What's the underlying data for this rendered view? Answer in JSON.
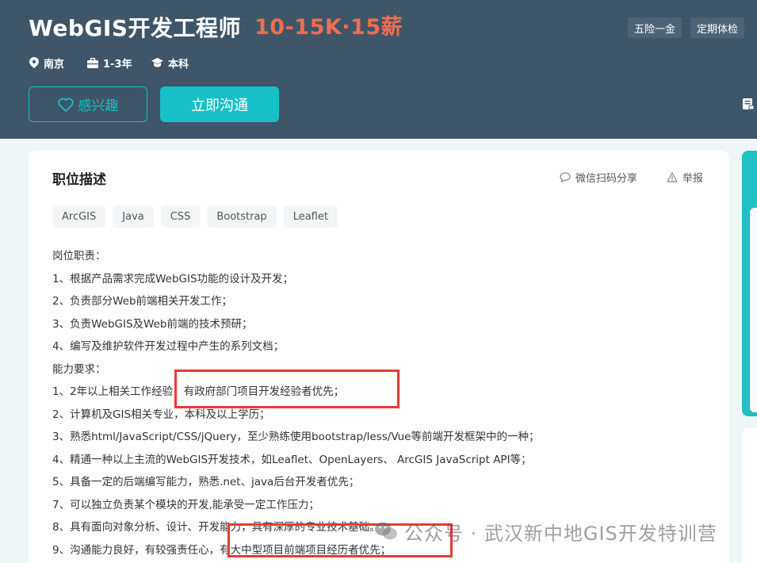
{
  "job": {
    "title": "WebGIS开发工程师",
    "salary": "10-15K·15薪",
    "city": "南京",
    "experience": "1-3年",
    "education": "本科"
  },
  "benefits": [
    "五险一金",
    "定期体检"
  ],
  "actions": {
    "interest_label": "感兴趣",
    "chat_label": "立即沟通"
  },
  "description": {
    "section_title": "职位描述",
    "share_label": "微信扫码分享",
    "report_label": "举报",
    "skills": [
      "ArcGIS",
      "Java",
      "CSS",
      "Bootstrap",
      "Leaflet"
    ],
    "lines": [
      "岗位职责：",
      "1、根据产品需求完成WebGIS功能的设计及开发；",
      "2、负责部分Web前端相关开发工作；",
      "3、负责WebGIS及Web前端的技术预研；",
      "4、编写及维护软件开发过程中产生的系列文档；",
      "能力要求：",
      "1、2年以上相关工作经验，有政府部门项目开发经验者优先；",
      "2、计算机及GIS相关专业，本科及以上学历；",
      "3、熟悉html/JavaScript/CSS/jQuery，至少熟练使用bootstrap/less/Vue等前端开发框架中的一种；",
      "4、精通一种以上主流的WebGIS开发技术，如Leaflet、OpenLayers、 ArcGIS JavaScript API等；",
      "5、具备一定的后端编写能力，熟悉.net、java后台开发者优先；",
      "7、可以独立负责某个模块的开发,能承受一定工作压力；",
      "8、具有面向对象分析、设计、开发能力，具有深厚的专业技术基础。",
      "9、沟通能力良好，有较强责任心，有大中型项目前端项目经历者优先；"
    ]
  },
  "watermark": "公众号 · 武汉新中地GIS开发特训营",
  "colors": {
    "header_bg": "#3f5668",
    "salary": "#f26d4f",
    "accent": "#17c0c6",
    "highlight_box": "#e83a36"
  },
  "icons": [
    "location-icon",
    "briefcase-icon",
    "graduation-cap-icon",
    "heart-icon",
    "chat-bubble-icon",
    "warning-icon",
    "document-icon",
    "wechat-icon"
  ]
}
